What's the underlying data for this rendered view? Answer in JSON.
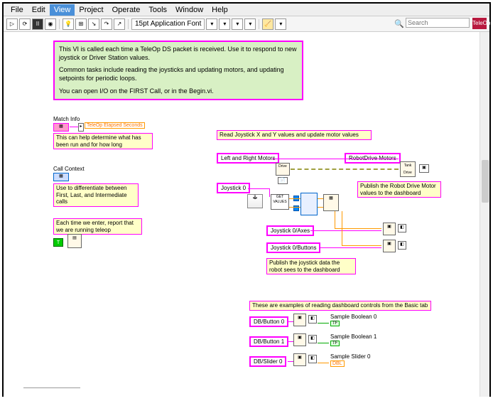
{
  "menubar": {
    "items": [
      "File",
      "Edit",
      "View",
      "Project",
      "Operate",
      "Tools",
      "Window",
      "Help"
    ],
    "active_index": 2
  },
  "toolbar": {
    "font": "15pt Application Font",
    "search_placeholder": "Search",
    "help_badge": "TeleOp"
  },
  "description": {
    "line1": "This VI is called each time a TeleOp DS packet is received.  Use it to respond to new joystick or Driver Station values.",
    "line2": "Common tasks include reading the joysticks and updating motors, and updating setpoints for periodic loops.",
    "line3": "You can open I/O on the FIRST Call, or in the Begin.vi."
  },
  "labels": {
    "match_info": "Match Info",
    "teleop_elapsed": "TeleOp Elapsed Seconds",
    "match_help": "This can help determine what has been run and for how long",
    "call_context": "Call Context",
    "call_help": "Use to differentiate between First, Last, and Intermediate calls",
    "enter_help": "Each time we enter, report that we are running teleop",
    "read_joy": "Read Joystick X and Y values and update motor values",
    "lr_motors": "Left and Right Motors",
    "robot_drive": "RobotDrive Motors",
    "joystick0": "Joystick 0",
    "joy_axes": "Joystick 0/Axes",
    "joy_buttons": "Joystick 0/Buttons",
    "publish_drive": "Publish the Robot Drive Motor values to the dashboard",
    "publish_joy": "Publish the joystick data the robot sees to the dashboard",
    "examples": "These are examples of reading dashboard controls from the Basic tab",
    "db_btn0": "DB/Button 0",
    "db_btn1": "DB/Button 1",
    "db_slider0": "DB/Slider 0",
    "sample_bool0": "Sample Boolean 0",
    "sample_bool1": "Sample Boolean 1",
    "sample_slider0": "Sample Slider 0",
    "get_values": "GET\nVALUES",
    "tf": "TF",
    "dbl": "DBL"
  }
}
